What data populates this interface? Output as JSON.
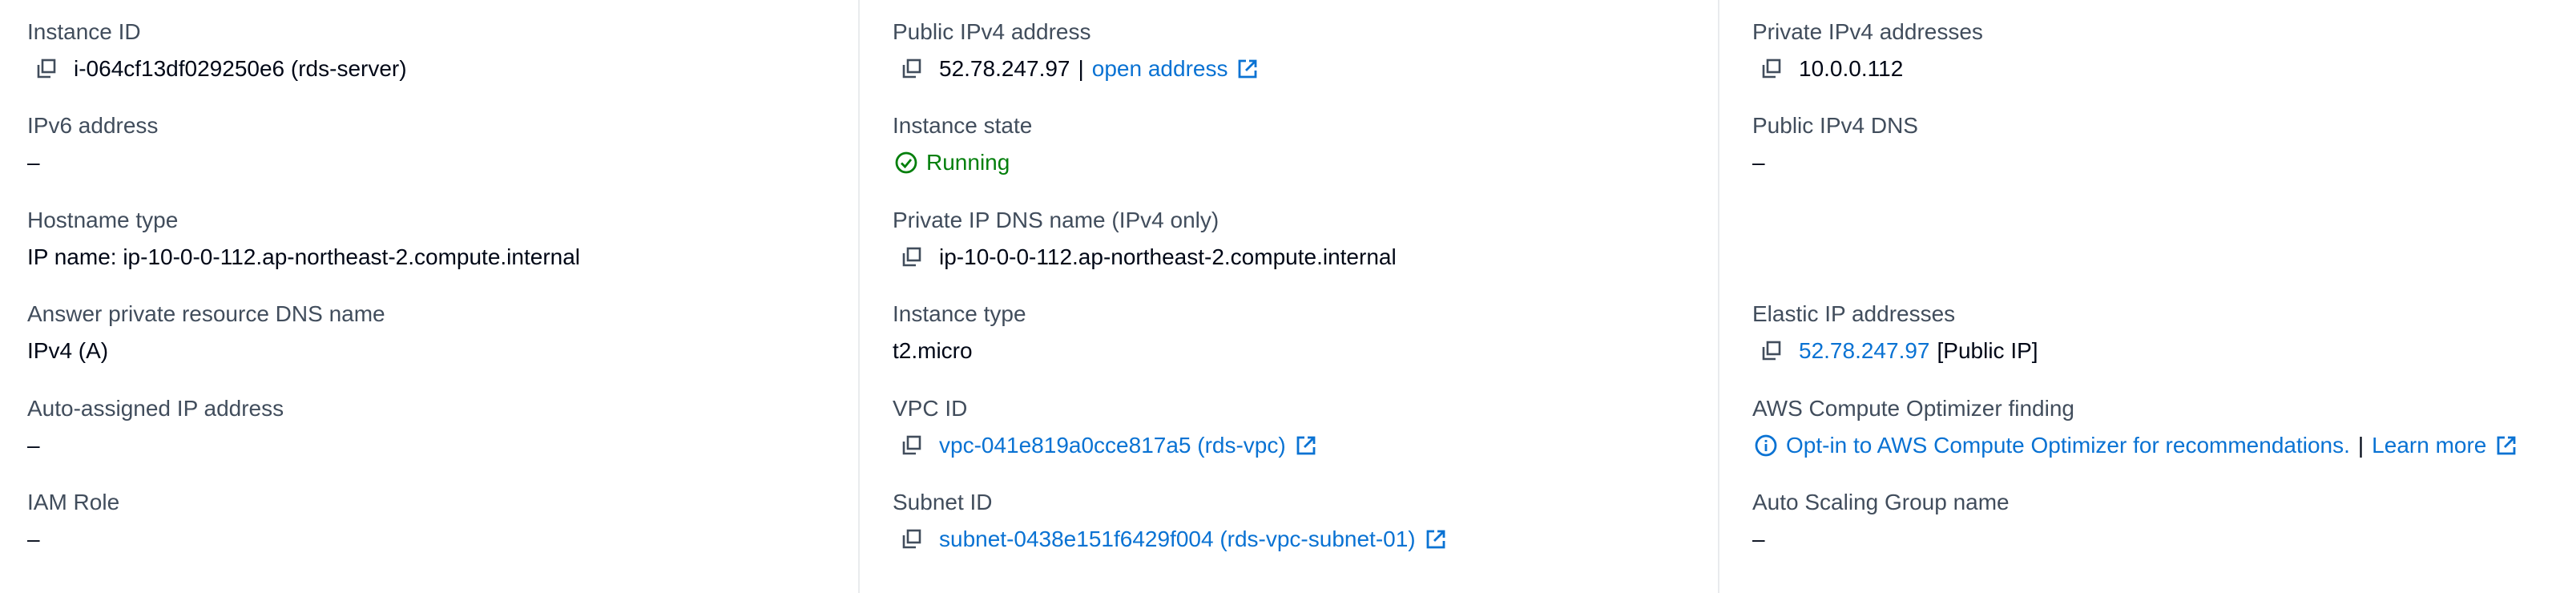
{
  "colors": {
    "label": "#414d5c",
    "value": "#000716",
    "link": "#0972d3",
    "success": "#037f0c",
    "divider": "#e9ebed"
  },
  "details": {
    "instance_id": {
      "label": "Instance ID",
      "value": "i-064cf13df029250e6 (rds-server)",
      "icon": "copy-icon"
    },
    "ipv6_address": {
      "label": "IPv6 address",
      "value": "–"
    },
    "hostname_type": {
      "label": "Hostname type",
      "value": "IP name: ip-10-0-0-112.ap-northeast-2.compute.internal"
    },
    "answer_private_dns": {
      "label": "Answer private resource DNS name",
      "value": "IPv4 (A)"
    },
    "auto_assigned_ip": {
      "label": "Auto-assigned IP address",
      "value": "–"
    },
    "iam_role": {
      "label": "IAM Role",
      "value": "–"
    },
    "public_ipv4": {
      "label": "Public IPv4 address",
      "value": "52.78.247.97",
      "separator": "|",
      "link_label": "open address",
      "icon": "copy-icon",
      "link_icon": "external-link-icon"
    },
    "instance_state": {
      "label": "Instance state",
      "value": "Running",
      "icon": "check-circle-icon"
    },
    "private_ip_dns": {
      "label": "Private IP DNS name (IPv4 only)",
      "value": "ip-10-0-0-112.ap-northeast-2.compute.internal",
      "icon": "copy-icon"
    },
    "instance_type": {
      "label": "Instance type",
      "value": "t2.micro"
    },
    "vpc_id": {
      "label": "VPC ID",
      "value": "vpc-041e819a0cce817a5 (rds-vpc)",
      "icon": "copy-icon",
      "link_icon": "external-link-icon"
    },
    "subnet_id": {
      "label": "Subnet ID",
      "value": "subnet-0438e151f6429f004 (rds-vpc-subnet-01)",
      "icon": "copy-icon",
      "link_icon": "external-link-icon"
    },
    "private_ipv4": {
      "label": "Private IPv4 addresses",
      "value": "10.0.0.112",
      "icon": "copy-icon"
    },
    "public_ipv4_dns": {
      "label": "Public IPv4 DNS",
      "value": "–"
    },
    "elastic_ip": {
      "label": "Elastic IP addresses",
      "value": "52.78.247.97",
      "suffix": "[Public IP]",
      "icon": "copy-icon"
    },
    "compute_optimizer": {
      "label": "AWS Compute Optimizer finding",
      "value": "Opt-in to AWS Compute Optimizer for recommendations.",
      "separator": "|",
      "link_label": "Learn more",
      "icon": "info-icon",
      "link_icon": "external-link-icon"
    },
    "asg_name": {
      "label": "Auto Scaling Group name",
      "value": "–"
    }
  }
}
